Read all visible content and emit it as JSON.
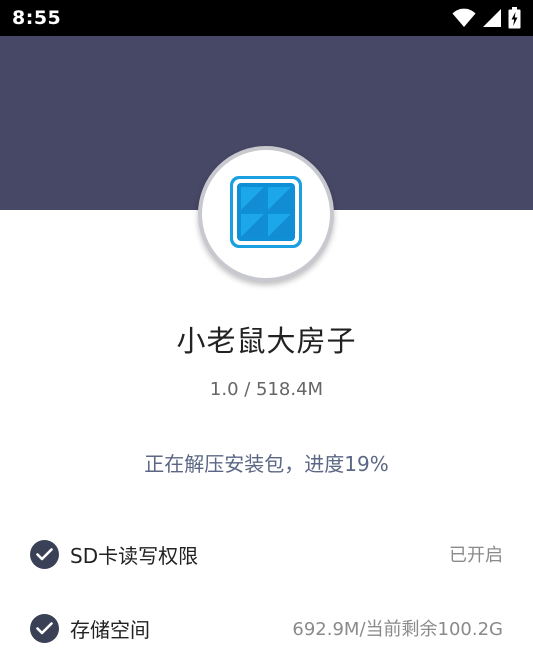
{
  "status_bar": {
    "time": "8:55",
    "icons": [
      "wifi-icon",
      "cell-signal-icon",
      "battery-charging-icon"
    ]
  },
  "app": {
    "name": "小老鼠大房子",
    "version_size": "1.0 / 518.4M",
    "icon": "windows-tile-icon"
  },
  "install": {
    "progress_text": "正在解压安装包，进度19%",
    "progress": 19
  },
  "permissions": [
    {
      "label": "SD卡读写权限",
      "value": "已开启"
    },
    {
      "label": "存储空间",
      "value": "692.9M/当前剩余100.2G"
    }
  ],
  "colors": {
    "header": "#474866",
    "status_bar": "#000000",
    "accent_text": "#5b6784",
    "check": "#3a4055"
  }
}
